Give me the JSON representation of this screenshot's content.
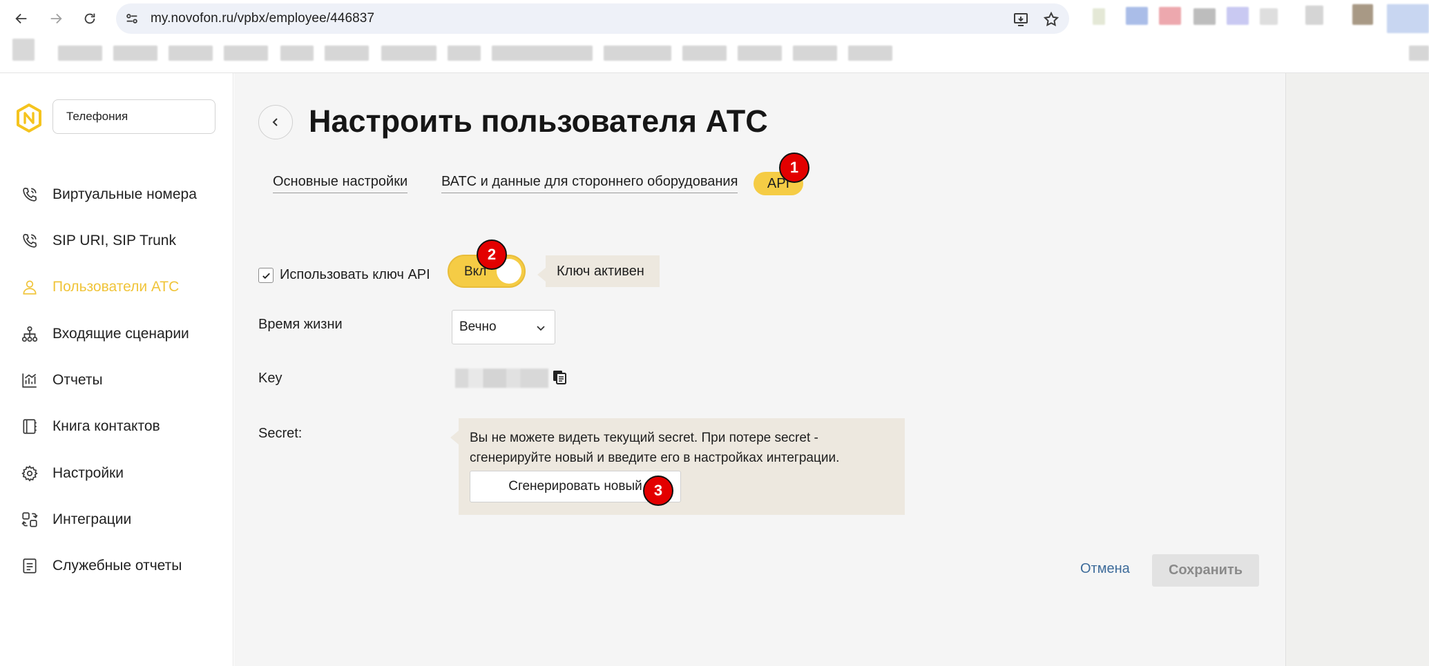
{
  "browser": {
    "url": "my.novofon.ru/vpbx/employee/446837"
  },
  "sidebar": {
    "section_select": "Телефония",
    "items": [
      {
        "label": "Виртуальные номера",
        "icon": "phone-icon",
        "active": false
      },
      {
        "label": "SIP URI, SIP Trunk",
        "icon": "phone-icon",
        "active": false
      },
      {
        "label": "Пользователи АТС",
        "icon": "user-icon",
        "active": true
      },
      {
        "label": "Входящие сценарии",
        "icon": "flow-icon",
        "active": false
      },
      {
        "label": "Отчеты",
        "icon": "chart-icon",
        "active": false
      },
      {
        "label": "Книга контактов",
        "icon": "contacts-book-icon",
        "active": false
      },
      {
        "label": "Настройки",
        "icon": "gear-icon",
        "active": false
      },
      {
        "label": "Интеграции",
        "icon": "integration-icon",
        "active": false
      },
      {
        "label": "Служебные отчеты",
        "icon": "document-icon",
        "active": false
      }
    ]
  },
  "main": {
    "title": "Настроить пользователя АТС",
    "tabs": [
      {
        "label": "Основные настройки",
        "active": false
      },
      {
        "label": "ВАТС и данные для стороннего оборудования",
        "active": false
      },
      {
        "label": "API",
        "active": true
      }
    ],
    "api": {
      "use_key_label": "Использовать ключ API",
      "use_key_checked": true,
      "toggle_label": "Вкл",
      "toggle_on": true,
      "key_status": "Ключ активен",
      "lifetime_label": "Время жизни",
      "lifetime_value": "Вечно",
      "key_label": "Key",
      "secret_label": "Secret:",
      "secret_note": "Вы не можете видеть текущий secret. При потере secret - сгенерируйте новый и введите его в настройках интеграции.",
      "generate_button": "Сгенерировать новый"
    },
    "actions": {
      "cancel": "Отмена",
      "save": "Сохранить"
    }
  },
  "markers": [
    "1",
    "2",
    "3"
  ],
  "colors": {
    "accent": "#f5cc45",
    "marker": "#e30000",
    "link": "#3d6b9a"
  }
}
